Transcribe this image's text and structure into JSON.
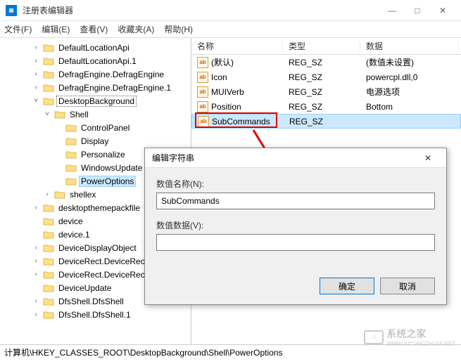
{
  "window": {
    "title": "注册表编辑器",
    "controls": {
      "minimize": "—",
      "maximize": "□",
      "close": "✕"
    }
  },
  "menu": {
    "file": "文件(F)",
    "edit": "编辑(E)",
    "view": "查看(V)",
    "favorites": "收藏夹(A)",
    "help": "帮助(H)"
  },
  "tree": {
    "items": [
      {
        "depth": 2,
        "toggle": ">",
        "label": "DefaultLocationApi"
      },
      {
        "depth": 2,
        "toggle": ">",
        "label": "DefaultLocationApi.1"
      },
      {
        "depth": 2,
        "toggle": ">",
        "label": "DefragEngine.DefragEngine"
      },
      {
        "depth": 2,
        "toggle": ">",
        "label": "DefragEngine.DefragEngine.1"
      },
      {
        "depth": 2,
        "toggle": "v",
        "label": "DesktopBackground",
        "sel_dotted": true
      },
      {
        "depth": 3,
        "toggle": "v",
        "label": "Shell"
      },
      {
        "depth": 4,
        "toggle": "",
        "label": "ControlPanel"
      },
      {
        "depth": 4,
        "toggle": "",
        "label": "Display"
      },
      {
        "depth": 4,
        "toggle": "",
        "label": "Personalize"
      },
      {
        "depth": 4,
        "toggle": "",
        "label": "WindowsUpdate"
      },
      {
        "depth": 4,
        "toggle": "",
        "label": "PowerOptions",
        "selected": true
      },
      {
        "depth": 3,
        "toggle": ">",
        "label": "shellex"
      },
      {
        "depth": 2,
        "toggle": ">",
        "label": "desktopthemepackfile"
      },
      {
        "depth": 2,
        "toggle": "",
        "label": "device"
      },
      {
        "depth": 2,
        "toggle": "",
        "label": "device.1"
      },
      {
        "depth": 2,
        "toggle": ">",
        "label": "DeviceDisplayObject"
      },
      {
        "depth": 2,
        "toggle": ">",
        "label": "DeviceRect.DeviceRect"
      },
      {
        "depth": 2,
        "toggle": ">",
        "label": "DeviceRect.DeviceRect.1"
      },
      {
        "depth": 2,
        "toggle": "",
        "label": "DeviceUpdate"
      },
      {
        "depth": 2,
        "toggle": ">",
        "label": "DfsShell.DfsShell"
      },
      {
        "depth": 2,
        "toggle": ">",
        "label": "DfsShell.DfsShell.1"
      }
    ]
  },
  "list": {
    "columns": {
      "name": "名称",
      "type": "类型",
      "data": "数据"
    },
    "col_widths": {
      "name": 130,
      "type": 110,
      "data": 140
    },
    "rows": [
      {
        "name": "(默认)",
        "type": "REG_SZ",
        "data": "(数值未设置)"
      },
      {
        "name": "Icon",
        "type": "REG_SZ",
        "data": "powercpl.dll,0"
      },
      {
        "name": "MUIVerb",
        "type": "REG_SZ",
        "data": "电源选项"
      },
      {
        "name": "Position",
        "type": "REG_SZ",
        "data": "Bottom"
      },
      {
        "name": "SubCommands",
        "type": "REG_SZ",
        "data": "",
        "selected": true
      }
    ]
  },
  "dialog": {
    "title": "编辑字符串",
    "name_label": "数值名称(N):",
    "name_value": "SubCommands",
    "data_label": "数值数据(V):",
    "data_value": "",
    "ok": "确定",
    "cancel": "取消",
    "close": "✕"
  },
  "statusbar": {
    "path": "计算机\\HKEY_CLASSES_ROOT\\DesktopBackground\\Shell\\PowerOptions"
  },
  "watermark": {
    "text": "系统之家",
    "url": "WWW.XITONGZHIJIA.NET"
  },
  "icons": {
    "string_value": "ab"
  }
}
